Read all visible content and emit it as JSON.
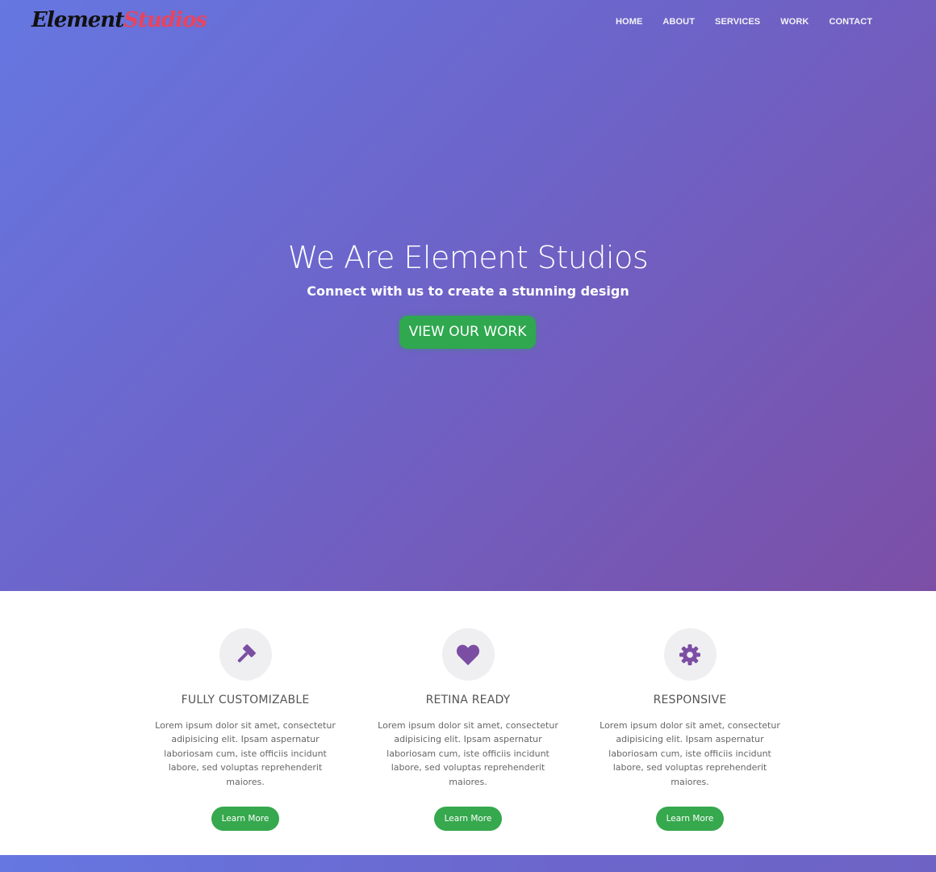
{
  "brand": {
    "part1": "Element",
    "part2": "Studios"
  },
  "nav": {
    "items": [
      "HOME",
      "ABOUT",
      "SERVICES",
      "WORK",
      "CONTACT"
    ]
  },
  "hero": {
    "title": "We Are Element Studios",
    "subtitle": "Connect with us to create a stunning design",
    "cta_label": "VIEW OUR WORK"
  },
  "features": [
    {
      "icon": "gavel-icon",
      "title": "FULLY CUSTOMIZABLE",
      "text": "Lorem ipsum dolor sit amet, consectetur adipisicing elit. Ipsam aspernatur laboriosam cum, iste officiis incidunt labore, sed voluptas reprehenderit maiores.",
      "button": "Learn More"
    },
    {
      "icon": "heart-icon",
      "title": "RETINA READY",
      "text": "Lorem ipsum dolor sit amet, consectetur adipisicing elit. Ipsam aspernatur laboriosam cum, iste officiis incidunt labore, sed voluptas reprehenderit maiores.",
      "button": "Learn More"
    },
    {
      "icon": "gear-icon",
      "title": "RESPONSIVE",
      "text": "Lorem ipsum dolor sit amet, consectetur adipisicing elit. Ipsam aspernatur laboriosam cum, iste officiis incidunt labore, sed voluptas reprehenderit maiores.",
      "button": "Learn More"
    }
  ],
  "colors": {
    "gradient_start": "#6677e1",
    "gradient_end": "#7c4fa6",
    "brand_dark": "#111111",
    "brand_accent": "#e8445e",
    "button_green": "#2fa84f",
    "icon_purple": "#7b4ea3"
  }
}
